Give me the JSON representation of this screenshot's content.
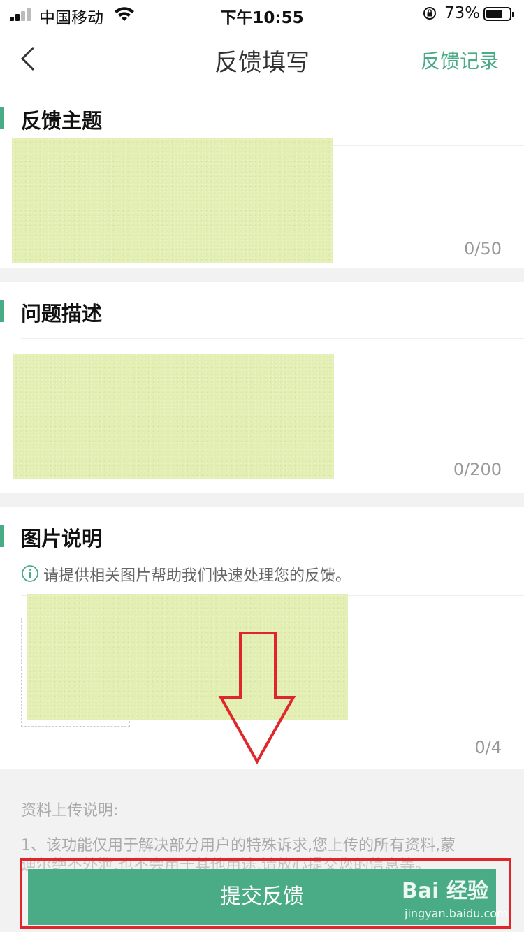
{
  "status_bar": {
    "carrier": "中国移动",
    "time": "下午10:55",
    "battery": "73%",
    "battery_level": 0.73
  },
  "nav": {
    "title": "反馈填写",
    "right_link": "反馈记录"
  },
  "sections": {
    "topic": {
      "title": "反馈主题",
      "counter": "0/50"
    },
    "description": {
      "title": "问题描述",
      "counter": "0/200"
    },
    "images": {
      "title": "图片说明",
      "hint": "请提供相关图片帮助我们快速处理您的反馈。",
      "counter": "0/4"
    }
  },
  "upload_info": {
    "title": "资料上传说明:",
    "line1": "1、该功能仅用于解决部分用户的特殊诉求,您上传的所有资料,蒙",
    "line2": "迪尔绝不外泄,也不会用于其他用途,请放心提交您的信息等。"
  },
  "submit": {
    "label": "提交反馈"
  },
  "watermark": {
    "logo": "Bai 经验",
    "sub": "jingyan.baidu.com"
  },
  "colors": {
    "accent": "#4aac86",
    "highlight_frame": "#e0262b",
    "redaction": "#e3eeb2"
  }
}
